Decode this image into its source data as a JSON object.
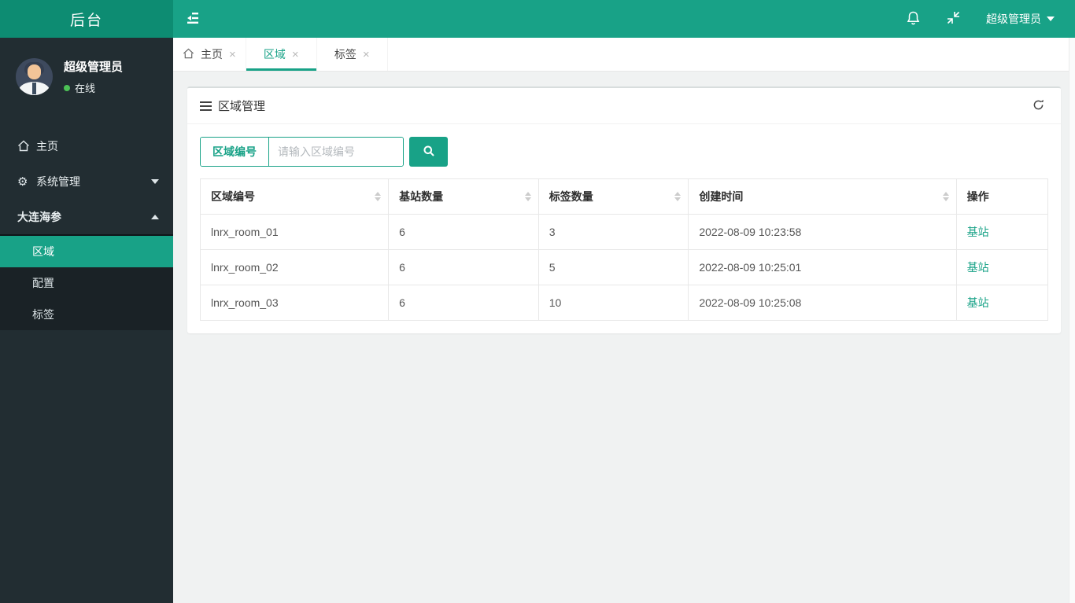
{
  "header": {
    "app_title": "后台",
    "user_menu_label": "超级管理员"
  },
  "sidebar": {
    "user_name": "超级管理员",
    "user_status": "在线",
    "menu": [
      {
        "label": "主页"
      },
      {
        "label": "系统管理"
      },
      {
        "label": "大连海参"
      }
    ],
    "submenu": [
      {
        "label": "区域"
      },
      {
        "label": "配置"
      },
      {
        "label": "标签"
      }
    ]
  },
  "tabs": [
    {
      "label": "主页"
    },
    {
      "label": "区域"
    },
    {
      "label": "标签"
    }
  ],
  "panel": {
    "title": "区域管理",
    "search_field_label": "区域编号",
    "search_placeholder": "请输入区域编号"
  },
  "table": {
    "columns": [
      "区域编号",
      "基站数量",
      "标签数量",
      "创建时间",
      "操作"
    ],
    "rows": [
      {
        "id": "lnrx_room_01",
        "stations": "6",
        "tags": "3",
        "time": "2022-08-09 10:23:58",
        "action": "基站"
      },
      {
        "id": "lnrx_room_02",
        "stations": "6",
        "tags": "5",
        "time": "2022-08-09 10:25:01",
        "action": "基站"
      },
      {
        "id": "lnrx_room_03",
        "stations": "6",
        "tags": "10",
        "time": "2022-08-09 10:25:08",
        "action": "基站"
      }
    ]
  },
  "icons": {
    "close": "×",
    "gear": "⚙"
  },
  "colors": {
    "brand_teal": "#18a287",
    "logo_teal": "#0d8c72",
    "sidebar_dark": "#222d32",
    "submenu_dark": "#1a2226",
    "online_green": "#4cc156",
    "content_bg": "#f0f2f2"
  }
}
